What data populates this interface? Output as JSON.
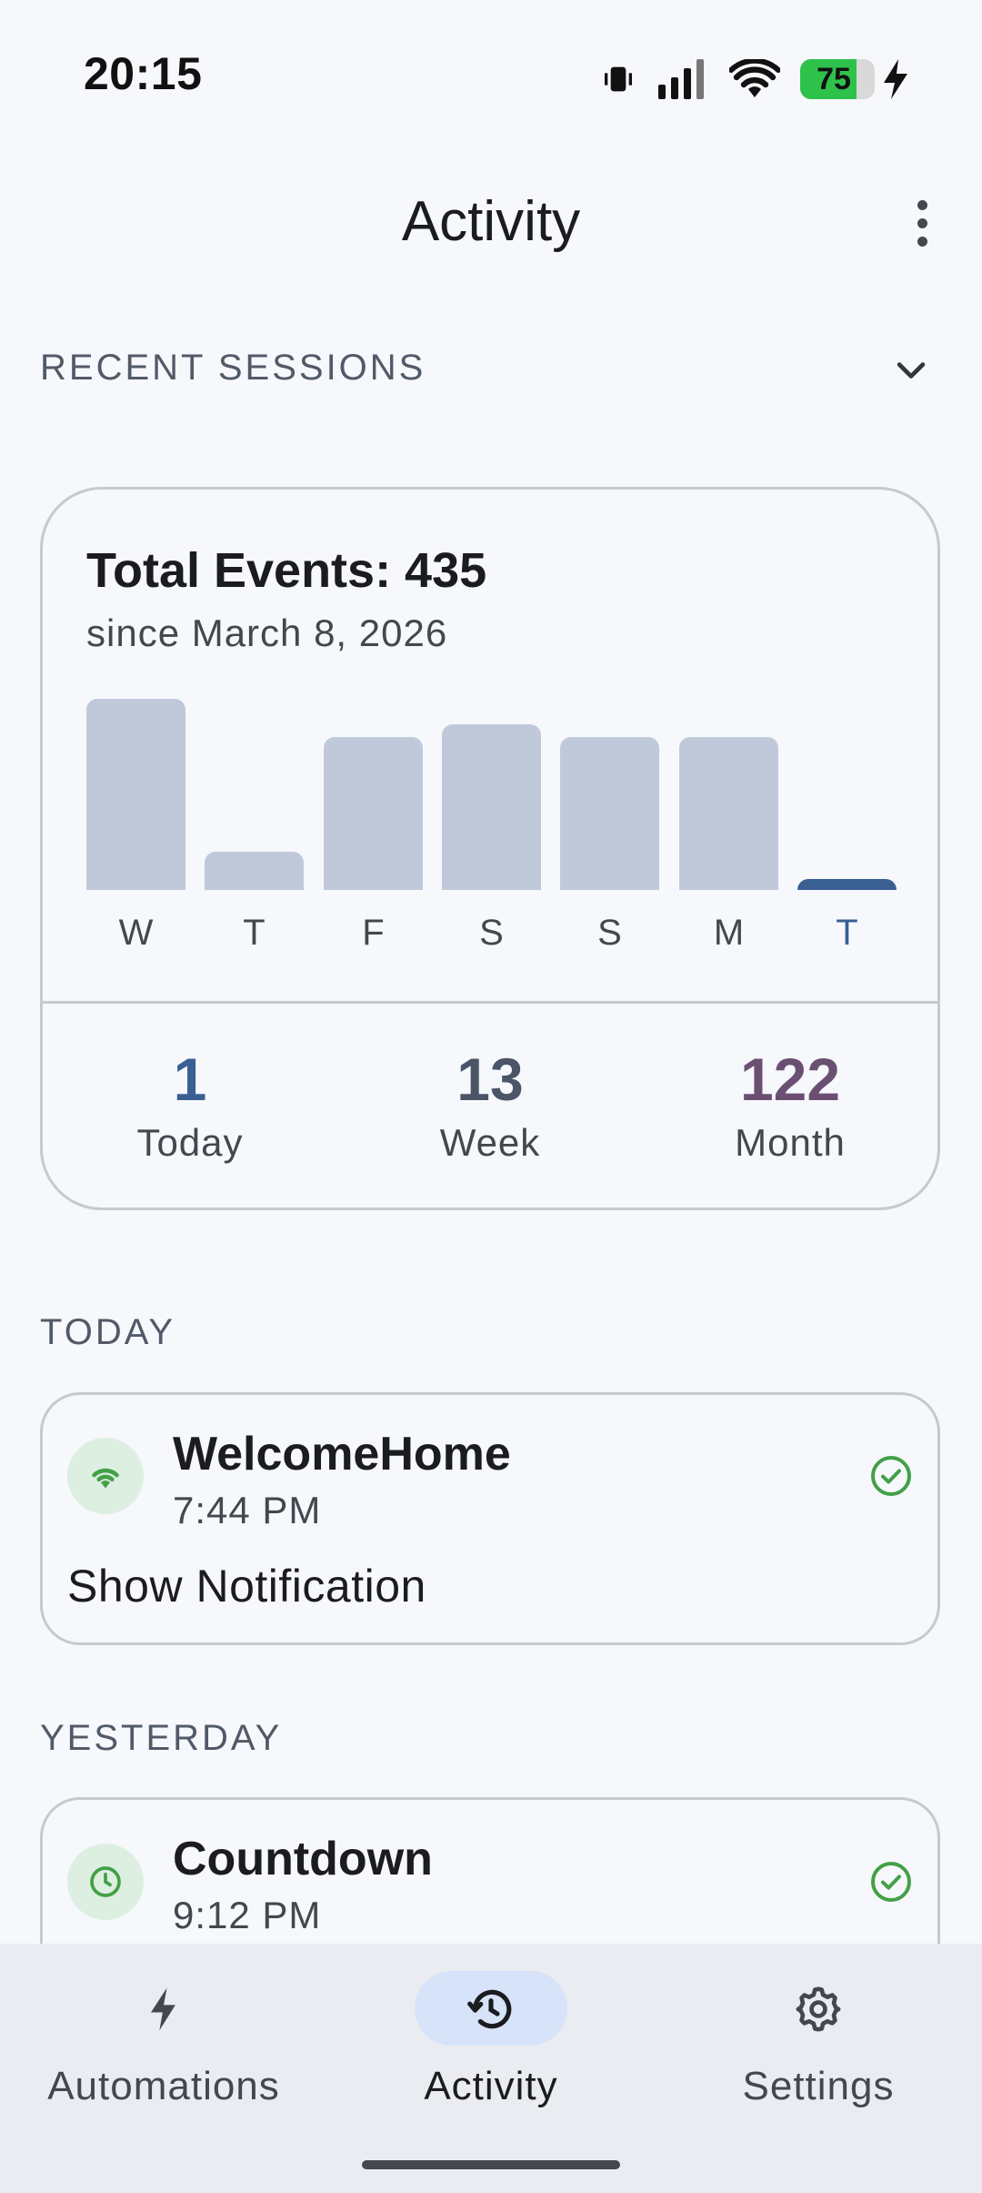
{
  "status_bar": {
    "time": "20:15",
    "battery_level": "75",
    "battery_fraction": 0.75
  },
  "header": {
    "title": "Activity"
  },
  "sections": {
    "recent": "RECENT SESSIONS",
    "today": "TODAY",
    "yesterday": "YESTERDAY"
  },
  "summary": {
    "title": "Total Events: 435",
    "subtitle": "since March 8, 2026",
    "stats": [
      {
        "value": "1",
        "label": "Today",
        "color": "#3a5f93"
      },
      {
        "value": "13",
        "label": "Week",
        "color": "#4a5568"
      },
      {
        "value": "122",
        "label": "Month",
        "color": "#6b4f72"
      }
    ]
  },
  "chart_data": {
    "type": "bar",
    "categories": [
      "W",
      "T",
      "F",
      "S",
      "S",
      "M",
      "T"
    ],
    "values": [
      20,
      4,
      16,
      17.3,
      16,
      16,
      1
    ],
    "highlight_index": 6,
    "colors": {
      "default": "#c0c9da",
      "highlight": "#3a5f93"
    }
  },
  "events": [
    {
      "name": "WelcomeHome",
      "time": "7:44 PM",
      "action": "Show Notification",
      "icon": "wifi-icon"
    },
    {
      "name": "Countdown",
      "time": "9:12 PM",
      "icon": "clock-icon"
    }
  ],
  "nav": {
    "items": [
      {
        "label": "Automations",
        "icon": "bolt-icon",
        "active": false
      },
      {
        "label": "Activity",
        "icon": "history-icon",
        "active": true
      },
      {
        "label": "Settings",
        "icon": "gear-icon",
        "active": false
      }
    ]
  },
  "colors": {
    "accent": "#3a5f93",
    "success": "#43a047",
    "background": "#f6f8fc"
  }
}
